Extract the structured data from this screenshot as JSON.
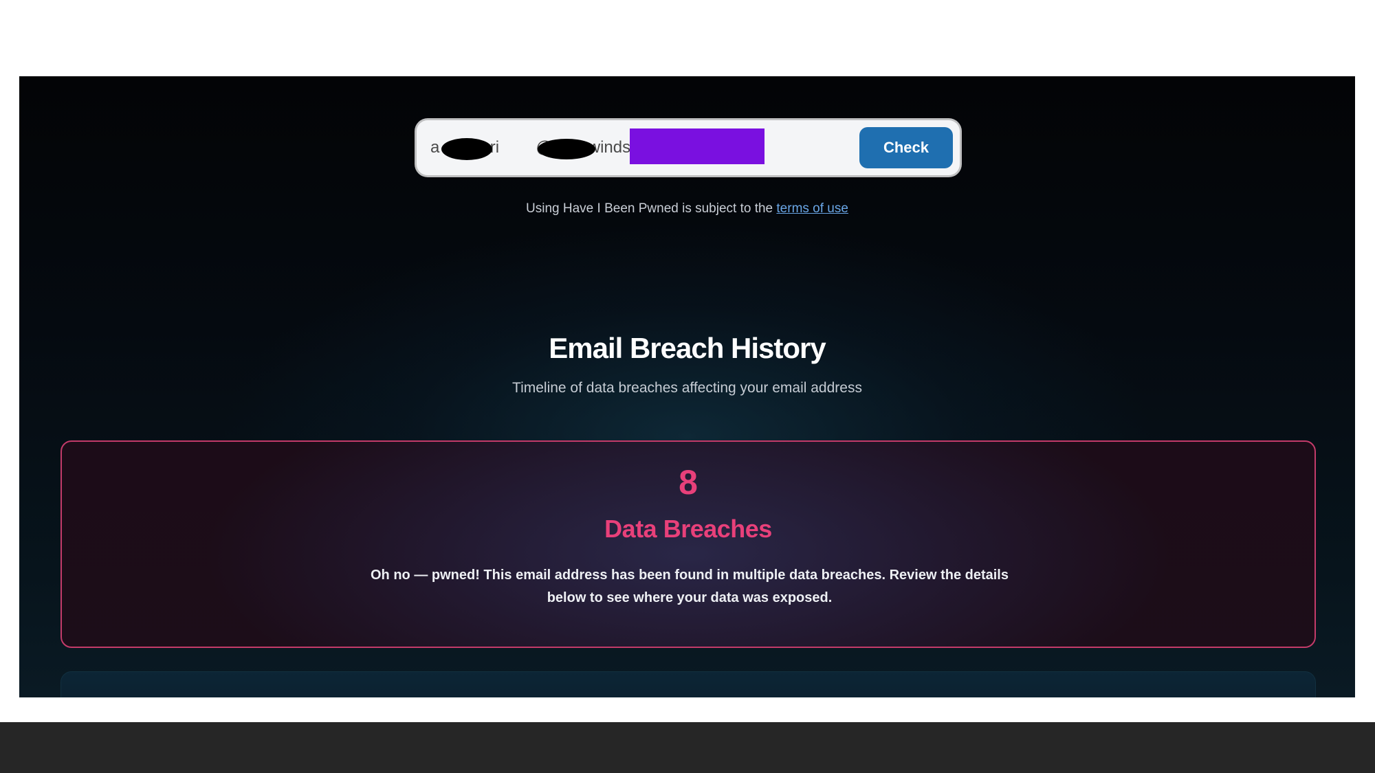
{
  "search": {
    "email_value": "a      .bori        @solarwinds.com",
    "check_label": "Check"
  },
  "terms": {
    "prefix": "Using Have I Been Pwned is subject to the ",
    "link_text": "terms of use"
  },
  "history": {
    "title": "Email Breach History",
    "subtitle": "Timeline of data breaches affecting your email address"
  },
  "summary": {
    "count": "8",
    "label": "Data Breaches",
    "message": "Oh no — pwned! This email address has been found in multiple data breaches. Review the details below to see where your data was exposed."
  },
  "colors": {
    "accent": "#e8407a",
    "button": "#1f6fb0",
    "link": "#6aa6e6",
    "highlight": "#7a10e0"
  }
}
